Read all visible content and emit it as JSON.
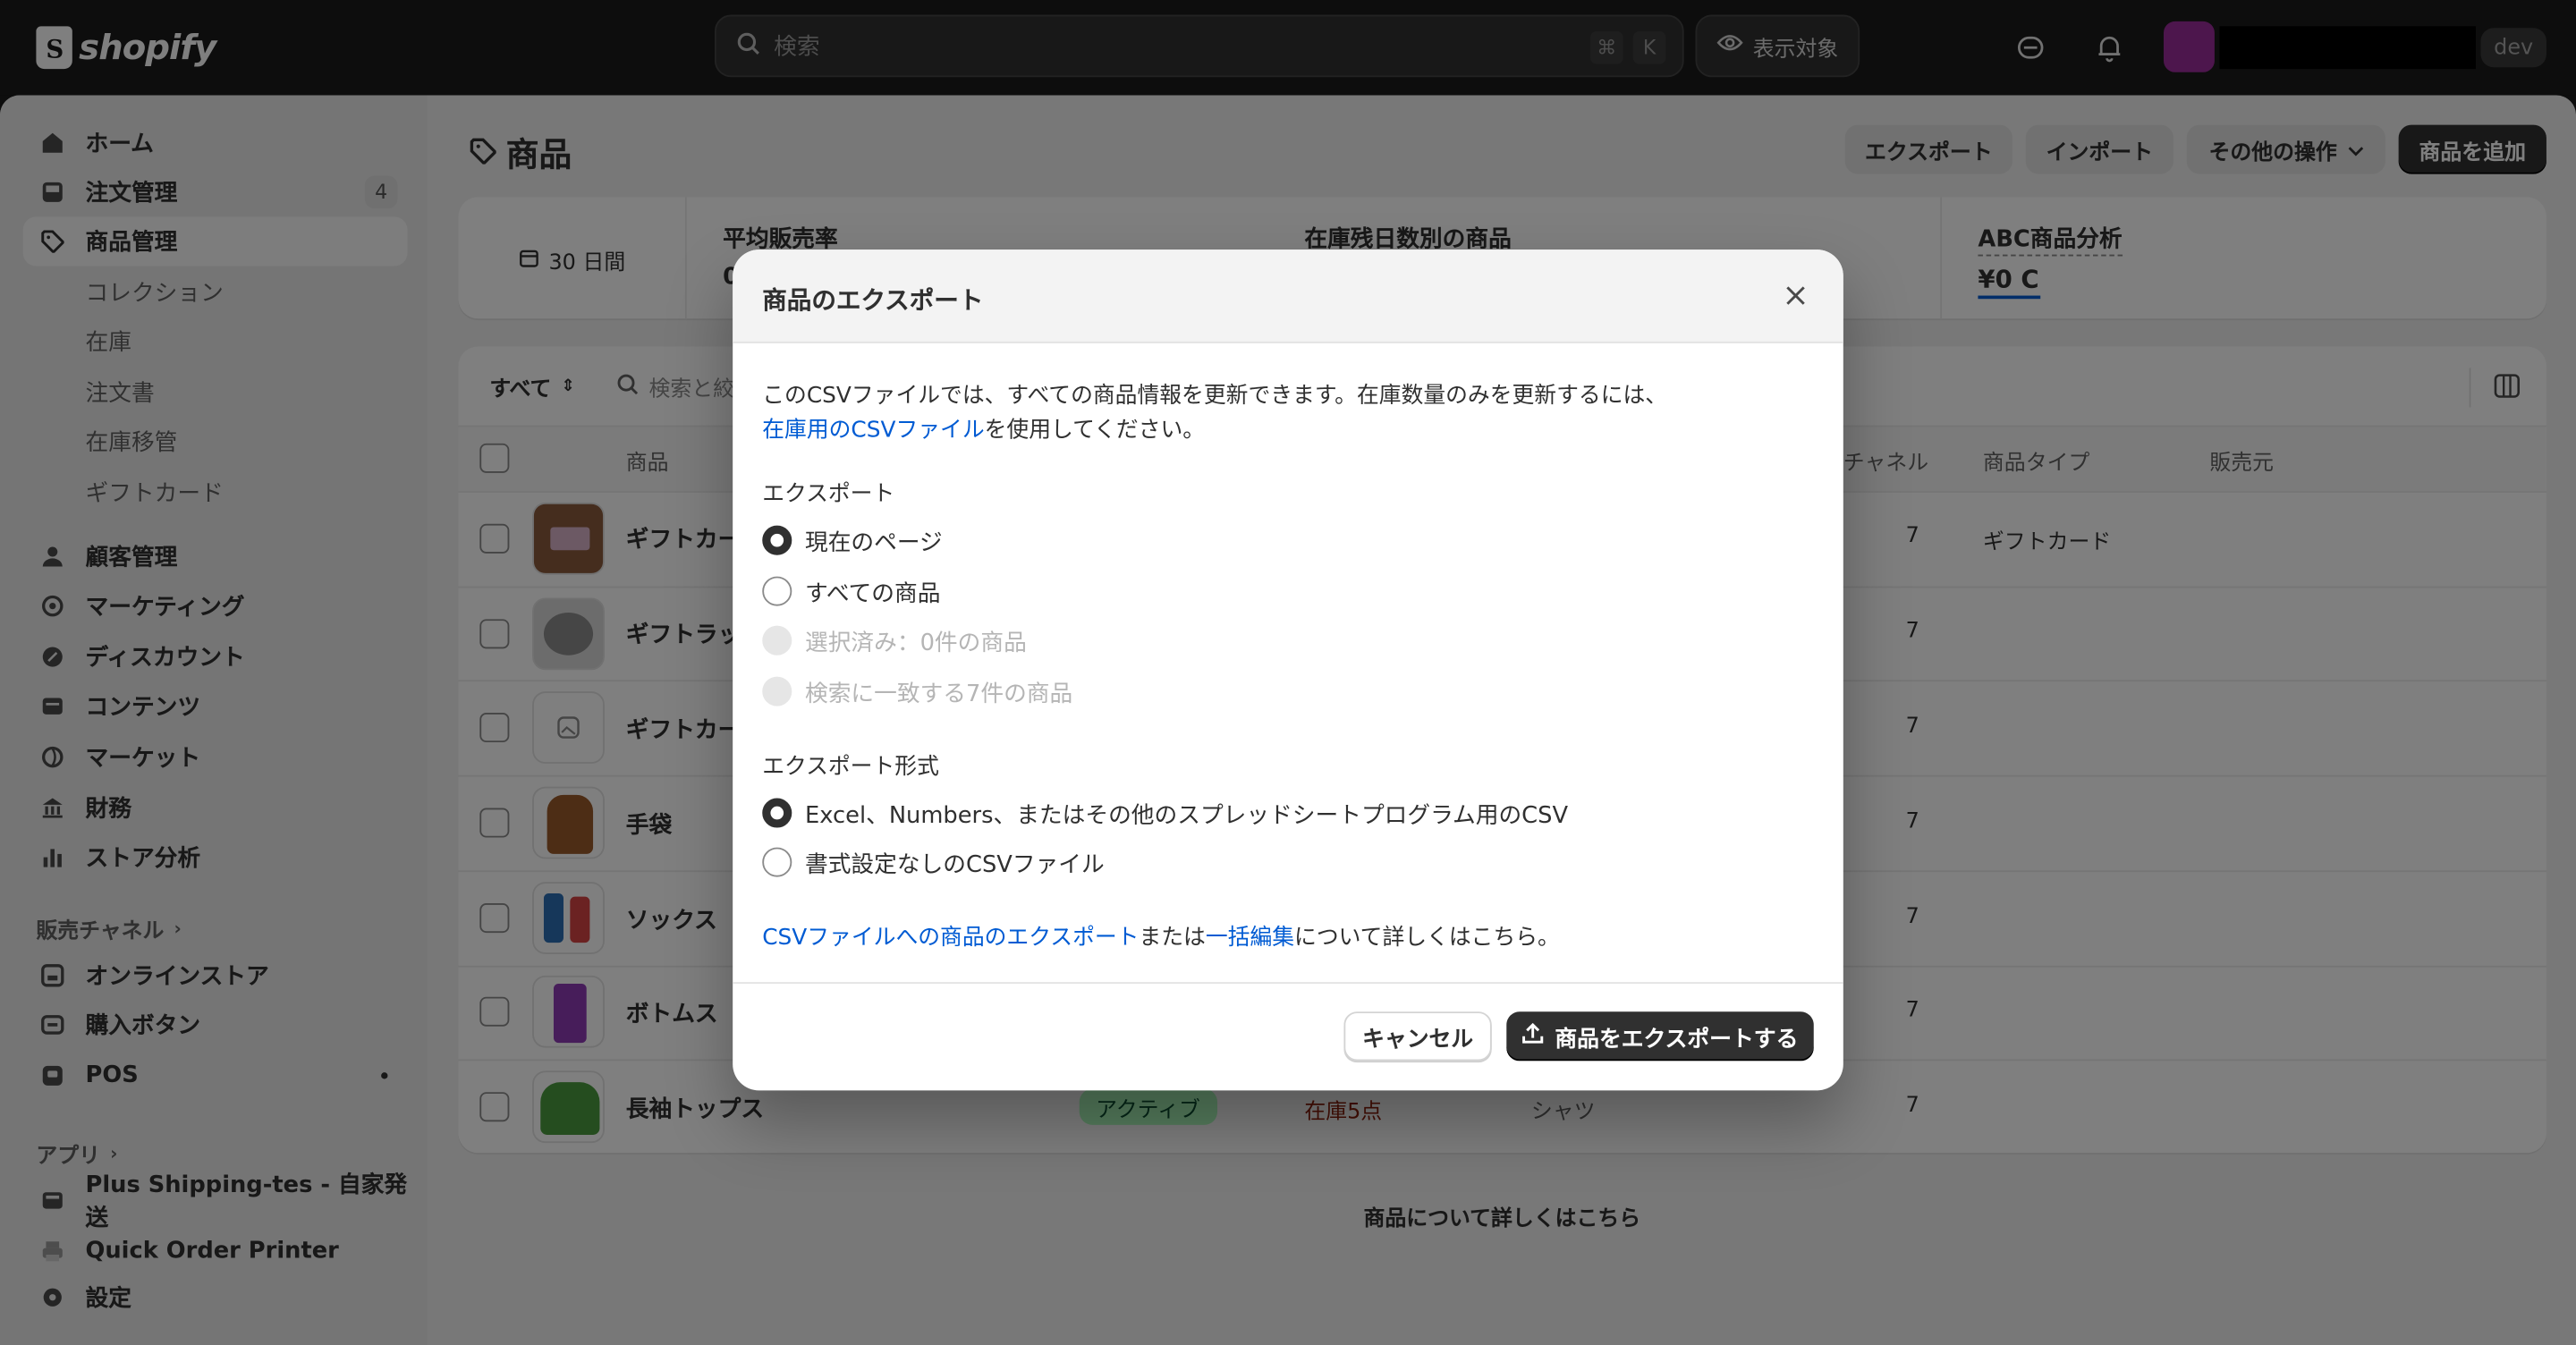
{
  "topbar": {
    "logo_text": "shopify",
    "search_placeholder": "検索",
    "shortcut_key1": "⌘",
    "shortcut_key2": "K",
    "view_button": "表示対象",
    "dev_badge": "dev"
  },
  "sidebar": {
    "items": [
      {
        "label": "ホーム",
        "icon": "home-icon"
      },
      {
        "label": "注文管理",
        "icon": "inbox-icon",
        "count": "4"
      },
      {
        "label": "商品管理",
        "icon": "tag-icon"
      },
      {
        "label": "コレクション"
      },
      {
        "label": "在庫"
      },
      {
        "label": "注文書"
      },
      {
        "label": "在庫移管"
      },
      {
        "label": "ギフトカード"
      },
      {
        "label": "顧客管理",
        "icon": "person-icon"
      },
      {
        "label": "マーケティング",
        "icon": "target-icon"
      },
      {
        "label": "ディスカウント",
        "icon": "discount-icon"
      },
      {
        "label": "コンテンツ",
        "icon": "content-icon"
      },
      {
        "label": "マーケット",
        "icon": "globe-icon"
      },
      {
        "label": "財務",
        "icon": "bank-icon"
      },
      {
        "label": "ストア分析",
        "icon": "chart-icon"
      }
    ],
    "sales_channels_label": "販売チャネル",
    "channels": [
      {
        "label": "オンラインストア",
        "icon": "store-icon"
      },
      {
        "label": "購入ボタン",
        "icon": "buy-button-icon"
      },
      {
        "label": "POS",
        "icon": "pos-icon"
      }
    ],
    "apps_label": "アプリ",
    "apps": [
      {
        "label": "Plus Shipping-tes - 自家発送",
        "icon": "app-icon"
      },
      {
        "label": "Quick Order Printer",
        "icon": "printer-icon"
      }
    ],
    "settings_label": "設定"
  },
  "page": {
    "title": "商品",
    "export_button": "エクスポート",
    "import_button": "インポート",
    "more_actions_button": "その他の操作",
    "add_product_button": "商品を追加",
    "date_range": "30 日間",
    "metrics": {
      "avg_sell_through": "平均販売率",
      "avg_sell_through_value": "0",
      "days_of_inventory": "在庫残日数別の商品",
      "abc_analysis": "ABC商品分析",
      "abc_value": "¥0 C"
    },
    "filter_all": "すべて",
    "filter_search_placeholder": "検索と絞",
    "columns": {
      "product": "商品",
      "channels": "チャネル",
      "product_type": "商品タイプ",
      "vendor": "販売元"
    },
    "rows": [
      {
        "name": "ギフトカー",
        "channels": "7",
        "type": "ギフトカード"
      },
      {
        "name": "ギフトラッ",
        "channels": "7",
        "type": ""
      },
      {
        "name": "ギフトカー",
        "channels": "7",
        "type": ""
      },
      {
        "name": "手袋",
        "channels": "7",
        "type": ""
      },
      {
        "name": "ソックス",
        "channels": "7",
        "type": ""
      },
      {
        "name": "ボトムス",
        "channels": "7",
        "type": ""
      },
      {
        "name": "長袖トップス",
        "channels": "7",
        "type": "",
        "status": "アクティブ",
        "inventory": "在庫5点",
        "category": "シャツ"
      }
    ],
    "learn_more": "商品について詳しくはこちら"
  },
  "modal": {
    "title": "商品のエクスポート",
    "description_line1": "このCSVファイルでは、すべての商品情報を更新できます。在庫数量のみを更新するには、",
    "description_link": "在庫用のCSVファイル",
    "description_line2": "を使用してください。",
    "export_label": "エクスポート",
    "export_options": [
      {
        "label": "現在のページ",
        "state": "selected"
      },
      {
        "label": "すべての商品",
        "state": "enabled"
      },
      {
        "label": "選択済み：0件の商品",
        "state": "disabled"
      },
      {
        "label": "検索に一致する7件の商品",
        "state": "disabled"
      }
    ],
    "format_label": "エクスポート形式",
    "format_options": [
      {
        "label": "Excel、Numbers、またはその他のスプレッドシートプログラム用のCSV",
        "state": "selected"
      },
      {
        "label": "書式設定なしのCSVファイル",
        "state": "enabled"
      }
    ],
    "help_link1": "CSVファイルへの商品のエクスポート",
    "help_middle": "または",
    "help_link2": "一括編集",
    "help_end": "について詳しくはこちら。",
    "cancel_button": "キャンセル",
    "export_button": "商品をエクスポートする"
  },
  "colors": {
    "topbar": "#1a1a1a",
    "link": "#005bd3",
    "primary_button": "#303030",
    "active_badge": "#affebf",
    "inventory_warning": "#8e1f0b"
  }
}
